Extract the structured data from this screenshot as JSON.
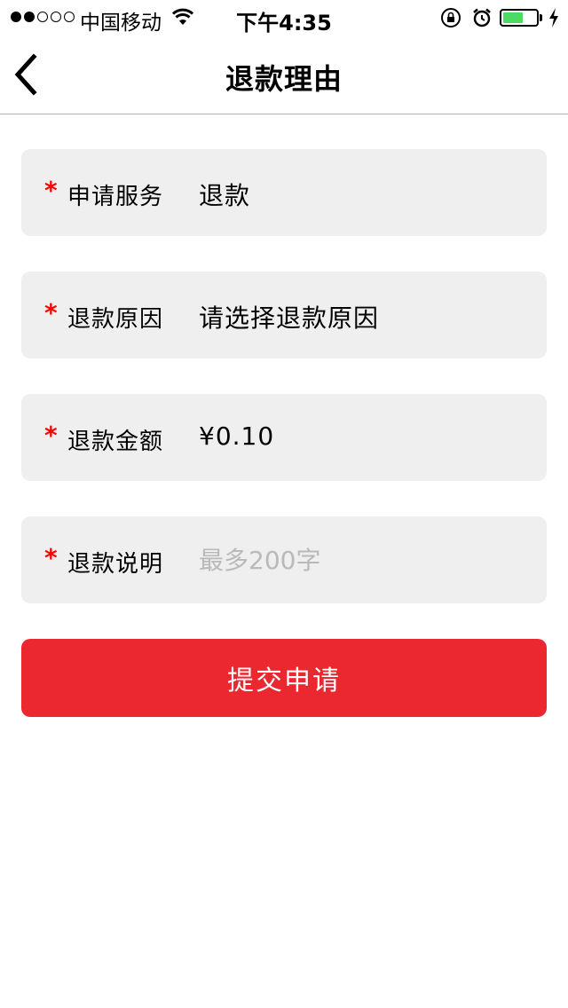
{
  "status_bar": {
    "carrier": "中国移动",
    "time": "下午4:35",
    "signal_strength_of_5": 2,
    "battery_level_pct": 60,
    "icons": [
      "signal-dots-icon",
      "wifi-icon",
      "orientation-lock-icon",
      "alarm-icon",
      "battery-icon",
      "charging-bolt-icon"
    ]
  },
  "nav": {
    "title": "退款理由",
    "back_icon": "chevron-left-icon"
  },
  "form": {
    "required_mark": "*",
    "service": {
      "label": "申请服务",
      "value": "退款"
    },
    "reason": {
      "label": "退款原因",
      "value": "请选择退款原因"
    },
    "amount": {
      "label": "退款金额",
      "value": "¥0.10"
    },
    "note": {
      "label": "退款说明",
      "placeholder": "最多200字",
      "value": ""
    }
  },
  "submit_label": "提交申请",
  "colors": {
    "accent": "#eb282f",
    "required": "#ff0000",
    "row_bg": "#efefef",
    "placeholder": "#b9b9b9",
    "battery": "#4cd964"
  }
}
